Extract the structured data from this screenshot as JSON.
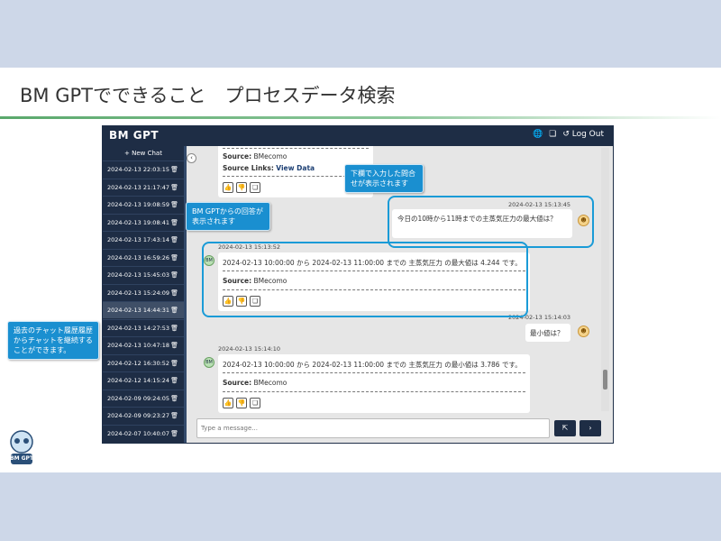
{
  "slide": {
    "title": "BM GPTでできること　プロセスデータ検索"
  },
  "app": {
    "logo": "BM GPT",
    "logout_label": "Log Out",
    "new_chat_label": "+ New Chat",
    "history": [
      "2024-02-13 22:03:15",
      "2024-02-13 21:17:47",
      "2024-02-13 19:08:59",
      "2024-02-13 19:08:41",
      "2024-02-13 17:43:14",
      "2024-02-13 16:59:26",
      "2024-02-13 15:45:03",
      "2024-02-13 15:24:09",
      "2024-02-13 14:44:31",
      "2024-02-13 14:27:53",
      "2024-02-13 10:47:18",
      "2024-02-12 16:30:52",
      "2024-02-12 14:15:24",
      "2024-02-09 09:24:05",
      "2024-02-09 09:23:27",
      "2024-02-07 10:40:07"
    ],
    "active_history_index": 8,
    "input_placeholder": "Type a message...",
    "colors": {
      "header": "#1e2d45",
      "accent": "#1a9bd7"
    }
  },
  "messages": {
    "top_card": {
      "source_label": "Source:",
      "source_value": "BMecomo",
      "links_label": "Source Links:",
      "links_value": "View Data"
    },
    "user1": {
      "timestamp": "2024-02-13 15:13:45",
      "text": "今日の10時から11時までの主蒸気圧力の最大値は？"
    },
    "bot1": {
      "timestamp": "2024-02-13 15:13:52",
      "text": "2024-02-13 10:00:00 から 2024-02-13 11:00:00 までの 主蒸気圧力 の最大値は 4.244 です。",
      "source_label": "Source:",
      "source_value": "BMecomo"
    },
    "user2": {
      "timestamp": "2024-02-13 15:14:03",
      "text": "最小値は？"
    },
    "bot2": {
      "timestamp": "2024-02-13 15:14:10",
      "text": "2024-02-13 10:00:00 から 2024-02-13 11:00:00 までの 主蒸気圧力 の最小値は 3.786 です。",
      "source_label": "Source:",
      "source_value": "BMecomo"
    }
  },
  "callouts": {
    "input_note": "下欄で入力した問合せが表示されます",
    "reply_note": "BM GPTからの回答が表示されます",
    "history_note": "過去のチャット履歴履歴からチャットを継続することができます。"
  },
  "mascot": {
    "label": "BM GPT"
  }
}
